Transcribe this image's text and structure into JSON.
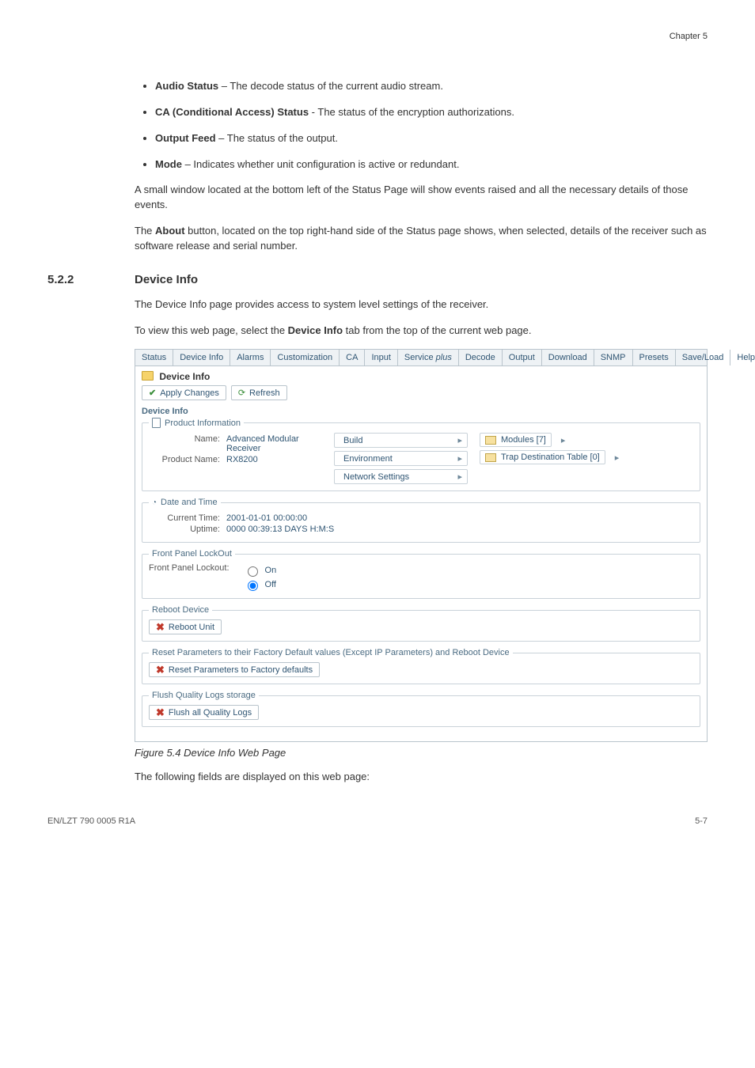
{
  "chapter": "Chapter 5",
  "bullets": [
    {
      "label": "Audio Status",
      "desc": " – The decode status of the current audio stream."
    },
    {
      "label": "CA (Conditional Access) Status",
      "desc": " - The status of the encryption authorizations."
    },
    {
      "label": "Output Feed",
      "desc": " – The status of the output."
    },
    {
      "label": "Mode",
      "desc": " – Indicates whether unit configuration is active or redundant."
    }
  ],
  "para1": "A small window located at the bottom left of the Status Page will show events raised and all the necessary details of those events.",
  "para2_pre": "The ",
  "para2_bold": "About",
  "para2_post": " button, located on the top right-hand side of the Status page shows, when selected, details of the receiver such as software release and serial number.",
  "sec_num": "5.2.2",
  "sec_title": "Device Info",
  "para3": "The Device Info page provides access to system level settings of the receiver.",
  "para4_pre": "To view this web page, select the ",
  "para4_bold": "Device Info",
  "para4_post": " tab from the top of the current web page.",
  "fig_caption": "Figure 5.4   Device Info Web Page",
  "para5": "The following fields are displayed on this web page:",
  "footer_left": "EN/LZT 790 0005 R1A",
  "footer_right": "5-7",
  "shot": {
    "tabs": [
      "Status",
      "Device Info",
      "Alarms",
      "Customization",
      "CA",
      "Input",
      "Service",
      "Decode",
      "Output",
      "Download",
      "SNMP",
      "Presets",
      "Save/Load",
      "Help"
    ],
    "service_italic": "plus",
    "pane_title": "Device Info",
    "btn_apply": "Apply Changes",
    "btn_refresh": "Refresh",
    "sub_header": "Device Info",
    "fs_product_legend": "Product Information",
    "name_k": "Name:",
    "name_v": "Advanced Modular Receiver",
    "prodname_k": "Product Name:",
    "prodname_v": "RX8200",
    "mi_build": "Build",
    "mi_env": "Environment",
    "mi_net": "Network Settings",
    "mi_modules": "Modules [7]",
    "mi_trap": "Trap Destination Table [0]",
    "fs_date_legend": "Date and Time",
    "curtime_k": "Current Time:",
    "curtime_v": "2001-01-01 00:00:00",
    "uptime_k": "Uptime:",
    "uptime_v": "0000 00:39:13 DAYS H:M:S",
    "fs_lockout_legend": "Front Panel LockOut",
    "fp_lock_k": "Front Panel Lockout:",
    "fp_on": "On",
    "fp_off": "Off",
    "fs_reboot_legend": "Reboot Device",
    "btn_reboot": "Reboot Unit",
    "fs_reset_legend": "Reset Parameters to their Factory Default values (Except IP Parameters) and Reboot Device",
    "btn_reset": "Reset Parameters to Factory defaults",
    "fs_flush_legend": "Flush Quality Logs storage",
    "btn_flush": "Flush all Quality Logs"
  }
}
